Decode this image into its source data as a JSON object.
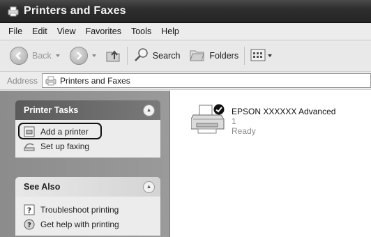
{
  "window": {
    "title": "Printers and Faxes"
  },
  "menu": {
    "items": [
      {
        "label": "File"
      },
      {
        "label": "Edit"
      },
      {
        "label": "View"
      },
      {
        "label": "Favorites"
      },
      {
        "label": "Tools"
      },
      {
        "label": "Help"
      }
    ]
  },
  "toolbar": {
    "back_label": "Back",
    "search_label": "Search",
    "folders_label": "Folders"
  },
  "address": {
    "label": "Address",
    "value": "Printers and Faxes"
  },
  "tasks_panel": {
    "title": "Printer Tasks",
    "items": [
      {
        "label": "Add a printer",
        "icon": "add-printer-icon"
      },
      {
        "label": "Set up faxing",
        "icon": "fax-icon"
      }
    ]
  },
  "see_also_panel": {
    "title": "See Also",
    "items": [
      {
        "label": "Troubleshoot printing",
        "icon": "help-icon"
      },
      {
        "label": "Get help with printing",
        "icon": "help-globe-icon"
      }
    ]
  },
  "printer": {
    "name": "EPSON XXXXXX  Advanced",
    "count": "1",
    "status": "Ready",
    "default_marker": "check-icon"
  }
}
